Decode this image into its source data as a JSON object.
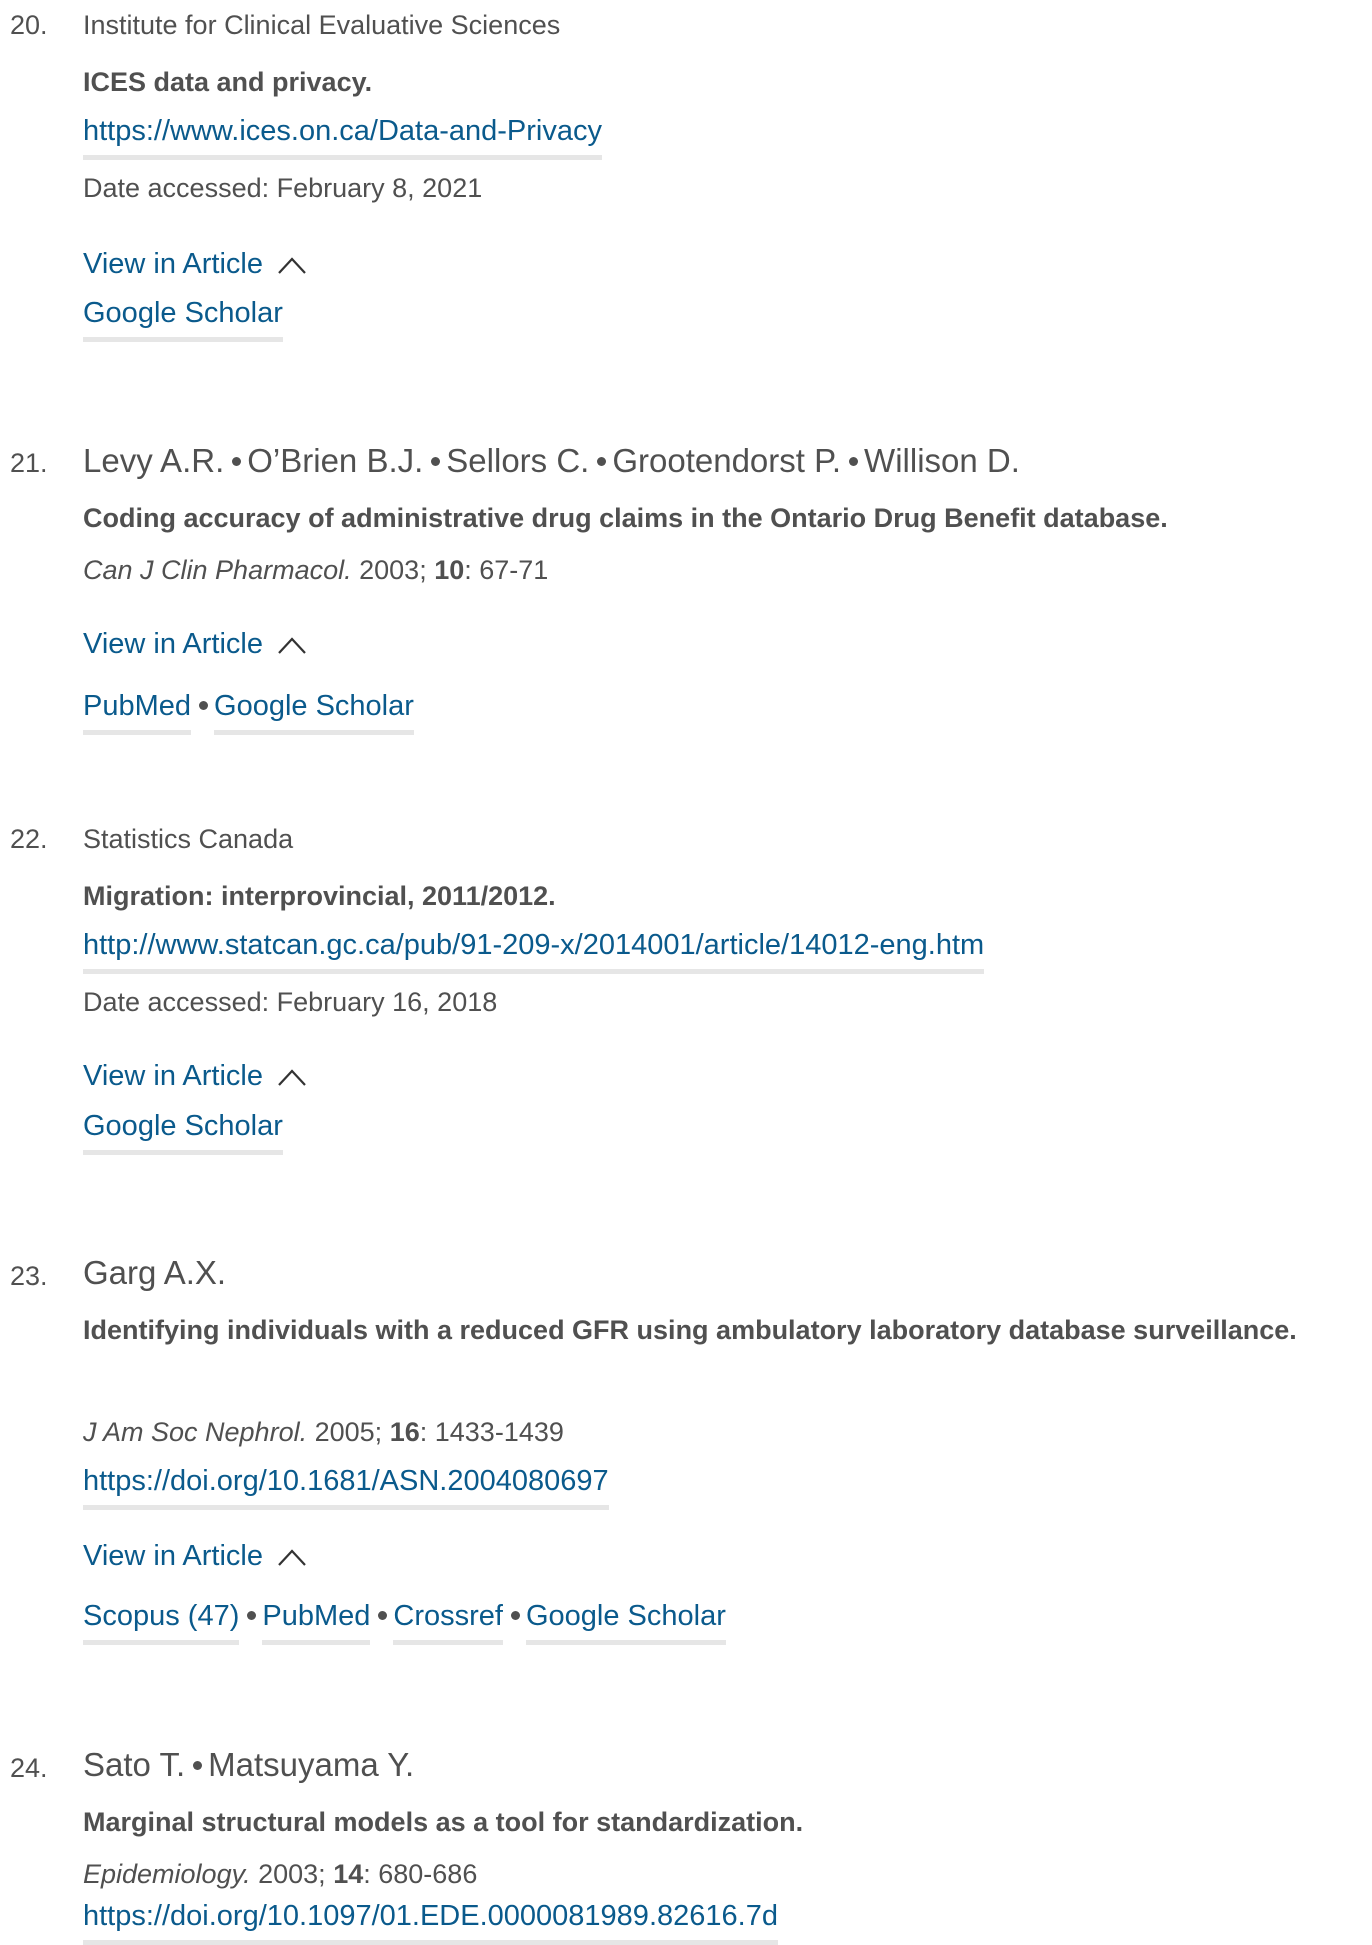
{
  "references": [
    {
      "number": "20.",
      "authors": [
        "Institute for Clinical Evaluative Sciences"
      ],
      "title": "ICES data and privacy.",
      "url": "https://www.ices.on.ca/Data-and-Privacy",
      "accessed": "Date accessed: February 8, 2021",
      "view_label": "View in Article",
      "links": [
        "Google Scholar"
      ]
    },
    {
      "number": "21.",
      "authors": [
        "Levy A.R.",
        "O’Brien B.J.",
        "Sellors C.",
        "Grootendorst P.",
        "Willison D."
      ],
      "title": "Coding accuracy of administrative drug claims in the Ontario Drug Benefit database.",
      "journal": "Can J Clin Pharmacol.",
      "year": "2003;",
      "volume": "10",
      "pages": ": 67-71",
      "view_label": "View in Article",
      "links": [
        "PubMed",
        "Google Scholar"
      ]
    },
    {
      "number": "22.",
      "authors": [
        "Statistics Canada"
      ],
      "title": "Migration: interprovincial, 2011/2012.",
      "url": "http://www.statcan.gc.ca/pub/91-209-x/2014001/article/14012-eng.htm",
      "accessed": "Date accessed: February 16, 2018",
      "view_label": "View in Article",
      "links": [
        "Google Scholar"
      ]
    },
    {
      "number": "23.",
      "authors": [
        "Garg A.X."
      ],
      "title": "Identifying individuals with a reduced GFR using ambulatory laboratory database surveillance.",
      "journal": "J Am Soc Nephrol.",
      "year": "2005;",
      "volume": "16",
      "pages": ": 1433-1439",
      "doi": "https://doi.org/10.1681/ASN.2004080697",
      "view_label": "View in Article",
      "links": [
        "Scopus (47)",
        "PubMed",
        "Crossref",
        "Google Scholar"
      ]
    },
    {
      "number": "24.",
      "authors": [
        "Sato T.",
        "Matsuyama Y."
      ],
      "title": "Marginal structural models as a tool for standardization.",
      "journal": "Epidemiology.",
      "year": "2003;",
      "volume": "14",
      "pages": ": 680-686",
      "doi": "https://doi.org/10.1097/01.EDE.0000081989.82616.7d"
    }
  ],
  "icons": {
    "collapse": "chevron-up-icon"
  }
}
